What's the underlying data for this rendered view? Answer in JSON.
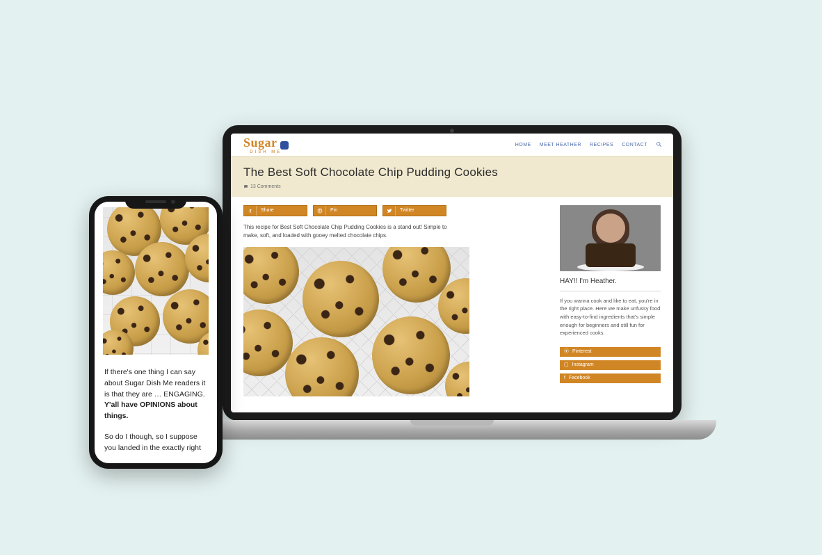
{
  "laptop": {
    "logo": {
      "script": "Sugar",
      "sub": "DISH ME"
    },
    "nav": [
      "HOME",
      "MEET HEATHER",
      "RECIPES",
      "CONTACT"
    ],
    "title": "The Best Soft Chocolate Chip Pudding Cookies",
    "comments": "13 Comments",
    "shares": [
      "Share",
      "Pin",
      "Twitter"
    ],
    "intro": "This recipe for Best Soft Chocolate Chip Pudding Cookies is a stand out! Simple to make, soft, and loaded with gooey melted chocolate chips.",
    "sidebar": {
      "heading": "HAY!! I'm Heather.",
      "text": "If you wanna cook and like to eat, you're in the right place. Here we make unfussy food with easy-to-find ingredients that's simple enough for beginners and still fun for experienced cooks.",
      "links": [
        "Pinterest",
        "Instagram",
        "Facebook"
      ]
    }
  },
  "phone": {
    "p1a": "If there's one thing I can say about Sugar Dish Me readers it is that they are … ENGAGING. ",
    "p1b": "Y'all have OPINIONS about things.",
    "p2": "So do I though, so I suppose you landed in the exactly right"
  }
}
